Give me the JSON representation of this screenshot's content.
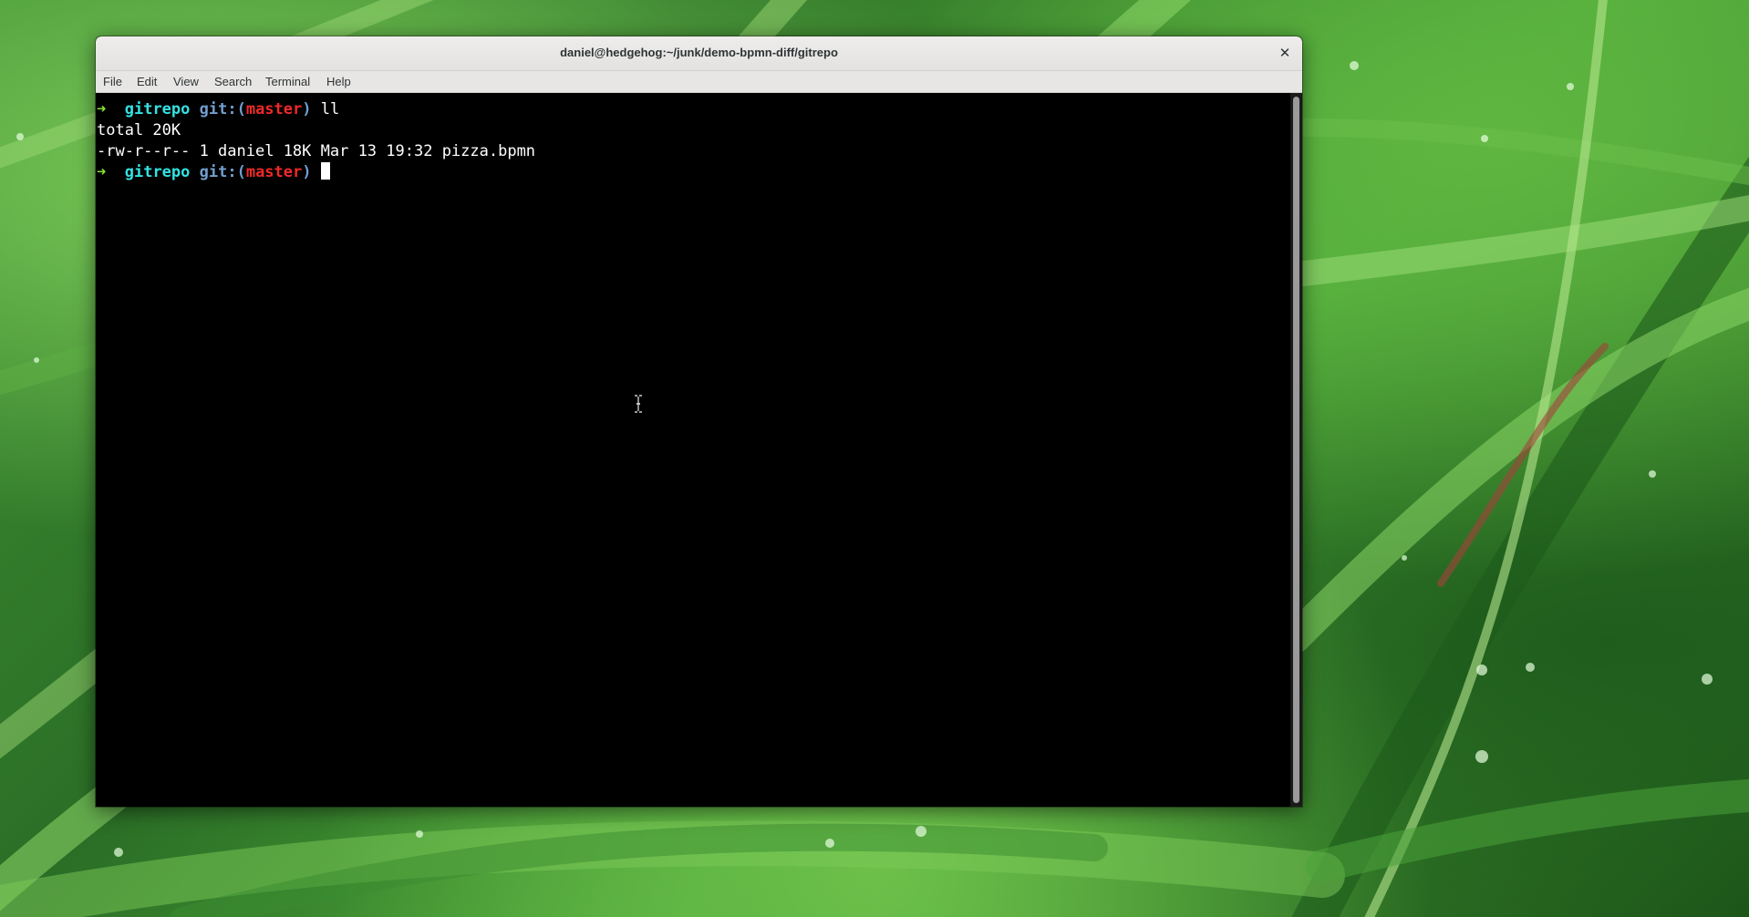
{
  "window": {
    "title": "daniel@hedgehog:~/junk/demo-bpmn-diff/gitrepo",
    "close_glyph": "✕"
  },
  "menubar": {
    "items": [
      "File",
      "Edit",
      "View",
      "Search",
      "Terminal",
      "Help"
    ]
  },
  "terminal": {
    "prompt": {
      "arrow": "➜",
      "directory": "gitrepo",
      "git_prefix": "git:(",
      "branch": "master",
      "git_suffix": ")"
    },
    "lines": [
      {
        "type": "prompt",
        "command": "ll"
      },
      {
        "type": "output",
        "text": "total 20K"
      },
      {
        "type": "output",
        "text": "-rw-r--r-- 1 daniel 18K Mar 13 19:32 pizza.bpmn"
      },
      {
        "type": "prompt",
        "command": ""
      }
    ],
    "colors": {
      "background": "#000000",
      "foreground": "#ffffff",
      "arrow": "#8ae234",
      "directory": "#34e2e2",
      "git": "#729fcf",
      "branch": "#ef2929"
    }
  },
  "icons": {
    "close": "close-icon",
    "mouse_cursor": "text-ibeam-cursor-icon",
    "terminal_cursor": "block-cursor-icon"
  }
}
